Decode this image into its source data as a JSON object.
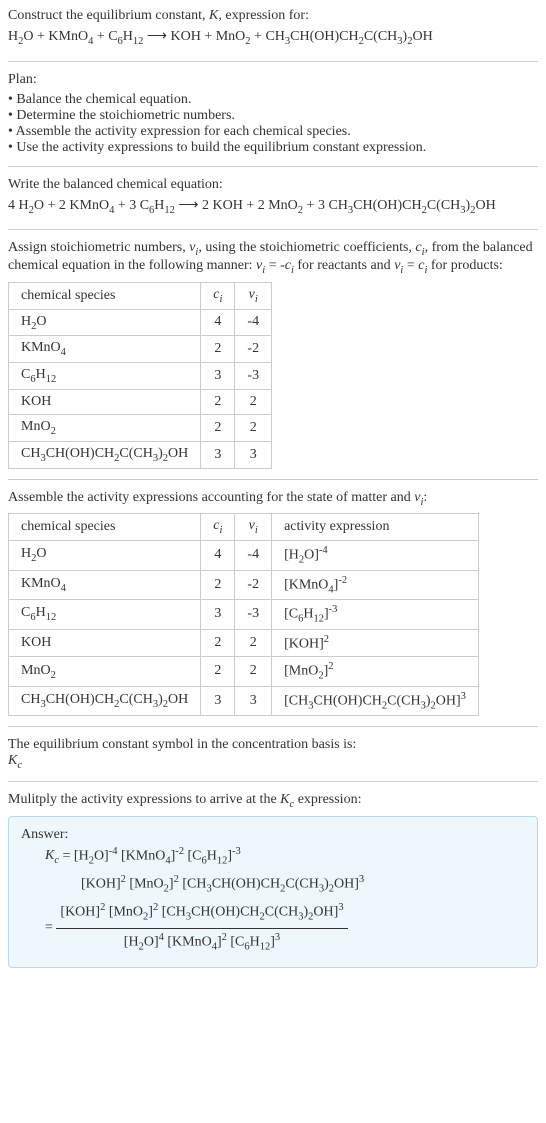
{
  "intro": {
    "line1": "Construct the equilibrium constant, K, expression for:",
    "equation": "H₂O + KMnO₄ + C₆H₁₂ ⟶ KOH + MnO₂ + CH₃CH(OH)CH₂C(CH₃)₂OH"
  },
  "plan": {
    "title": "Plan:",
    "items": [
      "Balance the chemical equation.",
      "Determine the stoichiometric numbers.",
      "Assemble the activity expression for each chemical species.",
      "Use the activity expressions to build the equilibrium constant expression."
    ]
  },
  "balanced": {
    "title": "Write the balanced chemical equation:",
    "equation": "4 H₂O + 2 KMnO₄ + 3 C₆H₁₂ ⟶ 2 KOH + 2 MnO₂ + 3 CH₃CH(OH)CH₂C(CH₃)₂OH"
  },
  "stoich": {
    "intro": "Assign stoichiometric numbers, νᵢ, using the stoichiometric coefficients, cᵢ, from the balanced chemical equation in the following manner: νᵢ = -cᵢ for reactants and νᵢ = cᵢ for products:",
    "headers": [
      "chemical species",
      "cᵢ",
      "νᵢ"
    ],
    "rows": [
      {
        "species": "H₂O",
        "c": "4",
        "v": "-4"
      },
      {
        "species": "KMnO₄",
        "c": "2",
        "v": "-2"
      },
      {
        "species": "C₆H₁₂",
        "c": "3",
        "v": "-3"
      },
      {
        "species": "KOH",
        "c": "2",
        "v": "2"
      },
      {
        "species": "MnO₂",
        "c": "2",
        "v": "2"
      },
      {
        "species": "CH₃CH(OH)CH₂C(CH₃)₂OH",
        "c": "3",
        "v": "3"
      }
    ]
  },
  "activity": {
    "intro": "Assemble the activity expressions accounting for the state of matter and νᵢ:",
    "headers": [
      "chemical species",
      "cᵢ",
      "νᵢ",
      "activity expression"
    ],
    "rows": [
      {
        "species": "H₂O",
        "c": "4",
        "v": "-4",
        "expr": "[H₂O]⁻⁴"
      },
      {
        "species": "KMnO₄",
        "c": "2",
        "v": "-2",
        "expr": "[KMnO₄]⁻²"
      },
      {
        "species": "C₆H₁₂",
        "c": "3",
        "v": "-3",
        "expr": "[C₆H₁₂]⁻³"
      },
      {
        "species": "KOH",
        "c": "2",
        "v": "2",
        "expr": "[KOH]²"
      },
      {
        "species": "MnO₂",
        "c": "2",
        "v": "2",
        "expr": "[MnO₂]²"
      },
      {
        "species": "CH₃CH(OH)CH₂C(CH₃)₂OH",
        "c": "3",
        "v": "3",
        "expr": "[CH₃CH(OH)CH₂C(CH₃)₂OH]³"
      }
    ]
  },
  "basis": {
    "line1": "The equilibrium constant symbol in the concentration basis is:",
    "line2": "K_c"
  },
  "multiply": {
    "intro": "Mulitply the activity expressions to arrive at the K_c expression:"
  },
  "answer": {
    "label": "Answer:",
    "line1": "K_c = [H₂O]⁻⁴ [KMnO₄]⁻² [C₆H₁₂]⁻³",
    "line2": "[KOH]² [MnO₂]² [CH₃CH(OH)CH₂C(CH₃)₂OH]³",
    "eq": "=",
    "frac_num": "[KOH]² [MnO₂]² [CH₃CH(OH)CH₂C(CH₃)₂OH]³",
    "frac_den": "[H₂O]⁴ [KMnO₄]² [C₆H₁₂]³"
  }
}
